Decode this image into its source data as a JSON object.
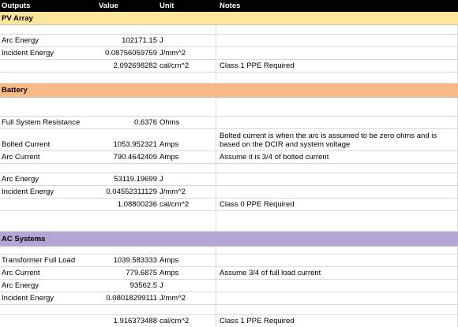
{
  "header": {
    "col_outputs": "Outputs",
    "col_value": "Value",
    "col_unit": "Unit",
    "col_notes": "Notes"
  },
  "colors": {
    "header_bg": "#000000",
    "pv_section_bg": "#fde59a",
    "battery_section_bg": "#f9b984",
    "ac_section_bg": "#b4a7d6"
  },
  "pv": {
    "title": "PV Array",
    "r1": {
      "label": "Arc Energy",
      "value": "102171.15",
      "unit": "J"
    },
    "r2": {
      "label": "Incident Energy",
      "value": "0.08756059759",
      "unit": "J/mm^2"
    },
    "r3": {
      "value": "2.092698282",
      "unit": "cal/cm^2",
      "note": "Class 1 PPE Required"
    }
  },
  "battery": {
    "title": "Battery",
    "r1": {
      "label": "Full System Resistance",
      "value": "0.6376",
      "unit": "Ohms"
    },
    "r2": {
      "label": "Bolted Current",
      "value": "1053.952321",
      "unit": "Amps",
      "note": "Bolted current is when the arc is assumed to be zero ohms and is based on the DCIR and system voltage"
    },
    "r3": {
      "label": "Arc Current",
      "value": "790.4642409",
      "unit": "Amps",
      "note": "Assume it is 3/4 of bolted current"
    },
    "r4": {
      "label": "Arc Energy",
      "value": "53119.19699",
      "unit": "J"
    },
    "r5": {
      "label": "Incident Energy",
      "value": "0.04552311129",
      "unit": "J/mm^2"
    },
    "r6": {
      "value": "1.08800236",
      "unit": "cal/cm^2",
      "note": "Class 0 PPE Required"
    }
  },
  "ac": {
    "title": "AC Systems",
    "r1": {
      "label": "Transformer Full Load",
      "value": "1039.583333",
      "unit": "Amps"
    },
    "r2": {
      "label": "Arc Current",
      "value": "779.6875",
      "unit": "Amps",
      "note": "Assume 3/4 of full load current"
    },
    "r3": {
      "label": "Arc Energy",
      "value": "93562.5",
      "unit": "J"
    },
    "r4": {
      "label": "Incident Energy",
      "value": "0.08018299111",
      "unit": "J/mm^2"
    },
    "r5": {
      "value": "1.916373488",
      "unit": "cal/cm^2",
      "note": "Class 1 PPE Required"
    }
  }
}
